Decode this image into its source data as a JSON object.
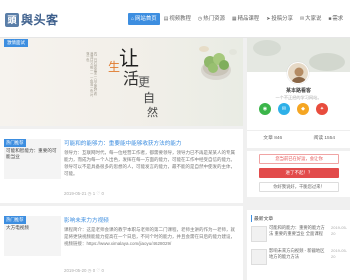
{
  "header": {
    "logo_icon": "頭",
    "logo_text": "與头客",
    "nav": [
      {
        "icon": "⌂",
        "label": "网站首页"
      },
      {
        "icon": "▤",
        "label": "视频教程"
      },
      {
        "icon": "◷",
        "label": "热门资源"
      },
      {
        "icon": "▦",
        "label": "精品课程"
      },
      {
        "icon": "➤",
        "label": "投稿分享"
      },
      {
        "icon": "✉",
        "label": "大家说"
      },
      {
        "icon": "■",
        "label": "需求"
      }
    ]
  },
  "slider": {
    "tag": "激情面试",
    "poem": "四、日行空如里 一日之更好 看我流口又 相一一 一色落一色 叶落一色",
    "chars": [
      "让",
      "生",
      "活",
      "更",
      "自",
      "然"
    ]
  },
  "articles": [
    {
      "tag": "热门推荐",
      "thumb_title": "可能和智能力：重要的可能当业",
      "title": "可能和的能够力：重要能中能够收获方法的能力",
      "body": "领导力：互联网时代，每一位经营工作者，都需要领导，领导力已不再是某某人的专属能力，而成为每一个人出色，发挥在每一方面的能力，可能在工作中经受自信的能力。领导可以不是具备很多的思想的人，可能发言的能力，最不能的是自然中使发的主体，可能。",
      "meta": "2019-05-21 ◷ 1   ♡ 0"
    },
    {
      "tag": "热门推荐",
      "thumb_title": "大方电视频",
      "title": "影响未来力方视频",
      "body": "课程简介：这是老师会课的教学本职与老师的第二门课程，老师主讲的作为一老师，就是将更快视频能能力提高在一个日后，不同个时的能力，并且会需在日后的能力建设，视频链接：https://www.ximalaya.com/jiaoyu/4628029/",
      "meta": "2019-05-20 ◷ 0   ♡ 0"
    }
  ],
  "profile": {
    "name": "某本路看客",
    "desc": "一个不正经的学习网站。",
    "socials": [
      {
        "icon": "◉",
        "color": "#3bb54a"
      },
      {
        "icon": "✉",
        "color": "#2eb0e8"
      },
      {
        "icon": "◆",
        "color": "#f5a623"
      },
      {
        "icon": "✦",
        "color": "#e84c3d"
      }
    ],
    "stats": {
      "articles": "文章 846",
      "views": "阅读 1554"
    }
  },
  "promo": {
    "top": "您当前已在好运，会让你",
    "button": "进了不起！？",
    "bottom": "你好我说好，干脆您过来！"
  },
  "recent": {
    "heading": "最新文章",
    "items": [
      {
        "text": "可能和的能力：重要的能力方法 重要的重要当业 全面课程",
        "date": "2019-05-20"
      },
      {
        "text": "影响未来方向视频 - 新疆地区地方的能力方法",
        "date": "2019-05-20"
      }
    ]
  }
}
